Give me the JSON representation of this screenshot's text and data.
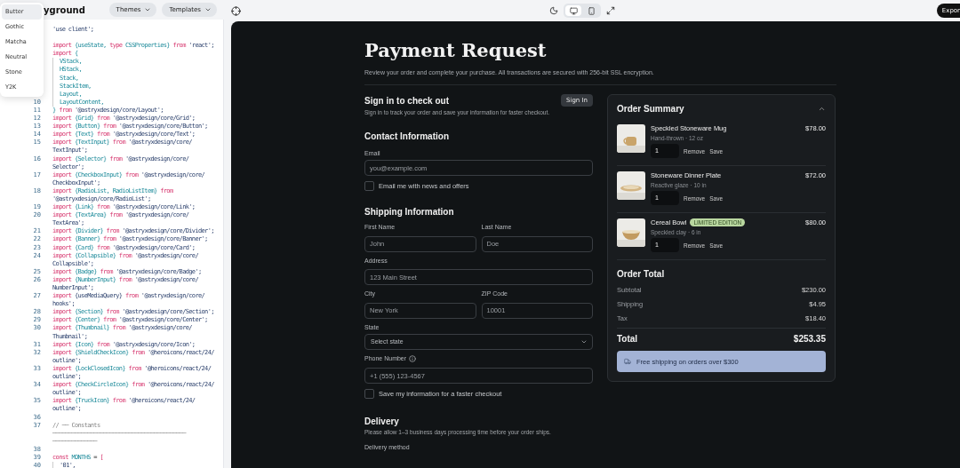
{
  "top_bar": {
    "title": "yground",
    "buttons": [
      {
        "label": "Themes"
      },
      {
        "label": "Templates"
      }
    ],
    "export_button": "Expor"
  },
  "theme_menu": {
    "items": [
      {
        "label": "Butter",
        "selected": true
      },
      {
        "label": "Gothic",
        "selected": false
      },
      {
        "label": "Matcha",
        "selected": false
      },
      {
        "label": "Neutral",
        "selected": false
      },
      {
        "label": "Stone",
        "selected": false
      },
      {
        "label": "Y2K",
        "selected": false
      }
    ]
  },
  "code": {
    "lines": [
      {
        "parts": [
          {
            "kind": "str",
            "text": "'use client';"
          }
        ]
      },
      {
        "space_before": true,
        "parts": [
          {
            "kind": "kw",
            "text": "import "
          },
          {
            "kind": "id",
            "text": "{useState, "
          },
          {
            "kind": "kw",
            "text": "type "
          },
          {
            "kind": "id",
            "text": "CSSProperties}"
          },
          {
            "kind": "kw",
            "text": " from "
          },
          {
            "kind": "str",
            "text": "'react';"
          }
        ]
      },
      {
        "parts": [
          {
            "kind": "kw",
            "text": "import "
          },
          {
            "kind": "id",
            "text": "{"
          }
        ]
      },
      {
        "guide": true,
        "parts": [
          {
            "kind": "id",
            "text": "VStack,"
          }
        ]
      },
      {
        "guide": true,
        "parts": [
          {
            "kind": "id",
            "text": "HStack,"
          }
        ]
      },
      {
        "guide": true,
        "parts": [
          {
            "kind": "id",
            "text": "Stack,"
          }
        ]
      },
      {
        "guide": true,
        "parts": [
          {
            "kind": "id",
            "text": "StackItem,"
          }
        ]
      },
      {
        "guide": true,
        "parts": [
          {
            "kind": "id",
            "text": "Layout,"
          }
        ]
      },
      {
        "num": "10",
        "guide": true,
        "parts": [
          {
            "kind": "id",
            "text": "LayoutContent,"
          }
        ]
      },
      {
        "num": "11",
        "parts": [
          {
            "kind": "id",
            "text": "}"
          },
          {
            "kind": "kw",
            "text": " from "
          },
          {
            "kind": "str",
            "text": "'@astryxdesign/core/Layout';"
          }
        ]
      },
      {
        "num": "12",
        "parts": [
          {
            "kind": "kw",
            "text": "import "
          },
          {
            "kind": "id",
            "text": "{Grid}"
          },
          {
            "kind": "kw",
            "text": " from "
          },
          {
            "kind": "str",
            "text": "'@astryxdesign/core/Grid';"
          }
        ]
      },
      {
        "num": "13",
        "parts": [
          {
            "kind": "kw",
            "text": "import "
          },
          {
            "kind": "id",
            "text": "{Button}"
          },
          {
            "kind": "kw",
            "text": " from "
          },
          {
            "kind": "str",
            "text": "'@astryxdesign/core/Button';"
          }
        ]
      },
      {
        "num": "14",
        "parts": [
          {
            "kind": "kw",
            "text": "import "
          },
          {
            "kind": "id",
            "text": "{Text}"
          },
          {
            "kind": "kw",
            "text": " from "
          },
          {
            "kind": "str",
            "text": "'@astryxdesign/core/Text';"
          }
        ]
      },
      {
        "num": "15",
        "parts": [
          {
            "kind": "kw",
            "text": "import "
          },
          {
            "kind": "id",
            "text": "{TextInput}"
          },
          {
            "kind": "kw",
            "text": " from "
          },
          {
            "kind": "str",
            "text": "'@astryxdesign/core/"
          }
        ],
        "wrap": [
          {
            "kind": "str",
            "text": "TextInput';"
          }
        ]
      },
      {
        "num": "16",
        "parts": [
          {
            "kind": "kw",
            "text": "import "
          },
          {
            "kind": "id",
            "text": "{Selector}"
          },
          {
            "kind": "kw",
            "text": " from "
          },
          {
            "kind": "str",
            "text": "'@astryxdesign/core/"
          }
        ],
        "wrap": [
          {
            "kind": "str",
            "text": "Selector';"
          }
        ]
      },
      {
        "num": "17",
        "parts": [
          {
            "kind": "kw",
            "text": "import "
          },
          {
            "kind": "id",
            "text": "{CheckboxInput}"
          },
          {
            "kind": "kw",
            "text": " from "
          },
          {
            "kind": "str",
            "text": "'@astryxdesign/core/"
          }
        ],
        "wrap": [
          {
            "kind": "str",
            "text": "CheckboxInput';"
          }
        ]
      },
      {
        "num": "18",
        "parts": [
          {
            "kind": "kw",
            "text": "import "
          },
          {
            "kind": "id",
            "text": "{RadioList, RadioListItem}"
          },
          {
            "kind": "kw",
            "text": " from"
          }
        ],
        "wrap": [
          {
            "kind": "str",
            "text": "'@astryxdesign/core/RadioList';"
          }
        ]
      },
      {
        "num": "19",
        "parts": [
          {
            "kind": "kw",
            "text": "import "
          },
          {
            "kind": "id",
            "text": "{Link}"
          },
          {
            "kind": "kw",
            "text": " from "
          },
          {
            "kind": "str",
            "text": "'@astryxdesign/core/Link';"
          }
        ]
      },
      {
        "num": "20",
        "parts": [
          {
            "kind": "kw",
            "text": "import "
          },
          {
            "kind": "id",
            "text": "{TextArea}"
          },
          {
            "kind": "kw",
            "text": " from "
          },
          {
            "kind": "str",
            "text": "'@astryxdesign/core/"
          }
        ],
        "wrap": [
          {
            "kind": "str",
            "text": "TextArea';"
          }
        ]
      },
      {
        "num": "21",
        "parts": [
          {
            "kind": "kw",
            "text": "import "
          },
          {
            "kind": "id",
            "text": "{Divider}"
          },
          {
            "kind": "kw",
            "text": " from "
          },
          {
            "kind": "str",
            "text": "'@astryxdesign/core/Divider';"
          }
        ]
      },
      {
        "num": "22",
        "parts": [
          {
            "kind": "kw",
            "text": "import "
          },
          {
            "kind": "id",
            "text": "{Banner}"
          },
          {
            "kind": "kw",
            "text": " from "
          },
          {
            "kind": "str",
            "text": "'@astryxdesign/core/Banner';"
          }
        ]
      },
      {
        "num": "23",
        "parts": [
          {
            "kind": "kw",
            "text": "import "
          },
          {
            "kind": "id",
            "text": "{Card}"
          },
          {
            "kind": "kw",
            "text": " from "
          },
          {
            "kind": "str",
            "text": "'@astryxdesign/core/Card';"
          }
        ]
      },
      {
        "num": "24",
        "parts": [
          {
            "kind": "kw",
            "text": "import "
          },
          {
            "kind": "id",
            "text": "{Collapsible}"
          },
          {
            "kind": "kw",
            "text": " from "
          },
          {
            "kind": "str",
            "text": "'@astryxdesign/core/"
          }
        ],
        "wrap": [
          {
            "kind": "str",
            "text": "Collapsible';"
          }
        ]
      },
      {
        "num": "25",
        "parts": [
          {
            "kind": "kw",
            "text": "import "
          },
          {
            "kind": "id",
            "text": "{Badge}"
          },
          {
            "kind": "kw",
            "text": " from "
          },
          {
            "kind": "str",
            "text": "'@astryxdesign/core/Badge';"
          }
        ]
      },
      {
        "num": "26",
        "parts": [
          {
            "kind": "kw",
            "text": "import "
          },
          {
            "kind": "id",
            "text": "{NumberInput}"
          },
          {
            "kind": "kw",
            "text": " from "
          },
          {
            "kind": "str",
            "text": "'@astryxdesign/core/"
          }
        ],
        "wrap": [
          {
            "kind": "str",
            "text": "NumberInput';"
          }
        ]
      },
      {
        "num": "27",
        "parts": [
          {
            "kind": "kw",
            "text": "import "
          },
          {
            "kind": "str",
            "text": "{useMediaQuery}"
          },
          {
            "kind": "kw",
            "text": " from "
          },
          {
            "kind": "str",
            "text": "'@astryxdesign/core/"
          }
        ],
        "wrap": [
          {
            "kind": "str",
            "text": "hooks';"
          }
        ]
      },
      {
        "num": "28",
        "parts": [
          {
            "kind": "kw",
            "text": "import "
          },
          {
            "kind": "id",
            "text": "{Section}"
          },
          {
            "kind": "kw",
            "text": " from "
          },
          {
            "kind": "str",
            "text": "'@astryxdesign/core/Section';"
          }
        ]
      },
      {
        "num": "29",
        "parts": [
          {
            "kind": "kw",
            "text": "import "
          },
          {
            "kind": "id",
            "text": "{Center}"
          },
          {
            "kind": "kw",
            "text": " from "
          },
          {
            "kind": "str",
            "text": "'@astryxdesign/core/Center';"
          }
        ]
      },
      {
        "num": "30",
        "parts": [
          {
            "kind": "kw",
            "text": "import "
          },
          {
            "kind": "id",
            "text": "{Thumbnail}"
          },
          {
            "kind": "kw",
            "text": " from "
          },
          {
            "kind": "str",
            "text": "'@astryxdesign/core/"
          }
        ],
        "wrap": [
          {
            "kind": "str",
            "text": "Thumbnail';"
          }
        ]
      },
      {
        "num": "31",
        "parts": [
          {
            "kind": "kw",
            "text": "import "
          },
          {
            "kind": "id",
            "text": "{Icon}"
          },
          {
            "kind": "kw",
            "text": " from "
          },
          {
            "kind": "str",
            "text": "'@astryxdesign/core/Icon';"
          }
        ]
      },
      {
        "num": "32",
        "parts": [
          {
            "kind": "kw",
            "text": "import "
          },
          {
            "kind": "id",
            "text": "{ShieldCheckIcon}"
          },
          {
            "kind": "kw",
            "text": " from "
          },
          {
            "kind": "str",
            "text": "'@heroicons/react/24/"
          }
        ],
        "wrap": [
          {
            "kind": "str",
            "text": "outline';"
          }
        ]
      },
      {
        "num": "33",
        "parts": [
          {
            "kind": "kw",
            "text": "import "
          },
          {
            "kind": "id",
            "text": "{LockClosedIcon}"
          },
          {
            "kind": "kw",
            "text": " from "
          },
          {
            "kind": "str",
            "text": "'@heroicons/react/24/"
          }
        ],
        "wrap": [
          {
            "kind": "str",
            "text": "outline';"
          }
        ]
      },
      {
        "num": "34",
        "parts": [
          {
            "kind": "kw",
            "text": "import "
          },
          {
            "kind": "id",
            "text": "{CheckCircleIcon}"
          },
          {
            "kind": "kw",
            "text": " from "
          },
          {
            "kind": "str",
            "text": "'@heroicons/react/24/"
          }
        ],
        "wrap": [
          {
            "kind": "str",
            "text": "outline';"
          }
        ]
      },
      {
        "num": "35",
        "parts": [
          {
            "kind": "kw",
            "text": "import "
          },
          {
            "kind": "id",
            "text": "{TruckIcon}"
          },
          {
            "kind": "kw",
            "text": " from "
          },
          {
            "kind": "str",
            "text": "'@heroicons/react/24/"
          }
        ],
        "wrap": [
          {
            "kind": "str",
            "text": "outline';"
          }
        ]
      },
      {
        "num": "36"
      },
      {
        "num": "37",
        "parts": [
          {
            "kind": "cm",
            "text": "// ── Constants"
          }
        ],
        "wrap": [
          {
            "kind": "cm",
            "text": "──────────────────────────────────────────"
          }
        ],
        "wrap2": [
          {
            "kind": "cm",
            "text": "──────────────"
          }
        ]
      },
      {
        "num": "38"
      },
      {
        "num": "39",
        "parts": [
          {
            "kind": "kw",
            "text": "const "
          },
          {
            "kind": "id",
            "text": "MONTHS"
          },
          {
            "kind": "pl",
            "text": " = "
          },
          {
            "kind": "kw",
            "text": "["
          }
        ]
      },
      {
        "num": "40",
        "guide": true,
        "parts": [
          {
            "kind": "str",
            "text": "'01',"
          }
        ]
      }
    ]
  },
  "preview_toolbar": {
    "view_modes": [
      {
        "kind": "desktop",
        "selected": true
      },
      {
        "kind": "mobile",
        "selected": false
      }
    ]
  },
  "page": {
    "title": "Payment Request",
    "subtitle": "Review your order and complete your purchase. All transactions are secured with 256-bit SSL encryption.",
    "sign_in": {
      "title": "Sign in to check out",
      "subtitle": "Sign in to track your order and save your information for faster checkout.",
      "button": "Sign In"
    },
    "contact": {
      "title": "Contact Information",
      "email_label": "Email",
      "email_placeholder": "you@example.com",
      "newsletter": {
        "label": "Email me with news and offers",
        "checked": false
      }
    },
    "shipping": {
      "title": "Shipping Information",
      "rows": [
        [
          {
            "kind": "text",
            "label": "First Name",
            "placeholder": "John"
          },
          {
            "kind": "text",
            "label": "Last Name",
            "placeholder": "Doe"
          }
        ],
        [
          {
            "kind": "text",
            "label": "Address",
            "placeholder": "123 Main Street"
          }
        ],
        [
          {
            "kind": "text",
            "label": "City",
            "placeholder": "New York"
          },
          {
            "kind": "text",
            "label": "ZIP Code",
            "placeholder": "10001"
          }
        ],
        [
          {
            "kind": "select",
            "label": "State",
            "placeholder": "Select state"
          }
        ],
        [
          {
            "kind": "text",
            "label": "Phone Number",
            "info": true,
            "placeholder": "+1 (555) 123-4567"
          }
        ]
      ],
      "save_info": {
        "label": "Save my information for a faster checkout",
        "checked": false
      }
    },
    "delivery": {
      "title": "Delivery",
      "subtitle": "Please allow 1–3 business days processing time before your order ships.",
      "method_label": "Delivery method"
    },
    "summary": {
      "title": "Order Summary",
      "expanded": true,
      "items": [
        {
          "name": "Speckled Stoneware Mug",
          "detail": "Hand-thrown · 12 oz",
          "price": "$78.00",
          "quantity": "1",
          "actions": [
            "Remove",
            "Save"
          ]
        },
        {
          "name": "Stoneware Dinner Plate",
          "detail": "Reactive glaze · 10 in",
          "price": "$72.00",
          "quantity": "1",
          "actions": [
            "Remove",
            "Save"
          ]
        },
        {
          "name": "Cereal Bowl",
          "badge": "LIMITED EDITION",
          "detail": "Speckled clay · 6 in",
          "price": "$80.00",
          "quantity": "1",
          "actions": [
            "Remove",
            "Save"
          ]
        }
      ],
      "total_title": "Order Total",
      "lines": [
        {
          "label": "Subtotal",
          "value": "$230.00"
        },
        {
          "label": "Shipping",
          "value": "$4.95"
        },
        {
          "label": "Tax",
          "value": "$18.40"
        }
      ],
      "total": {
        "label": "Total",
        "value": "$253.35"
      },
      "banner": "Free shipping on orders over $300"
    }
  }
}
